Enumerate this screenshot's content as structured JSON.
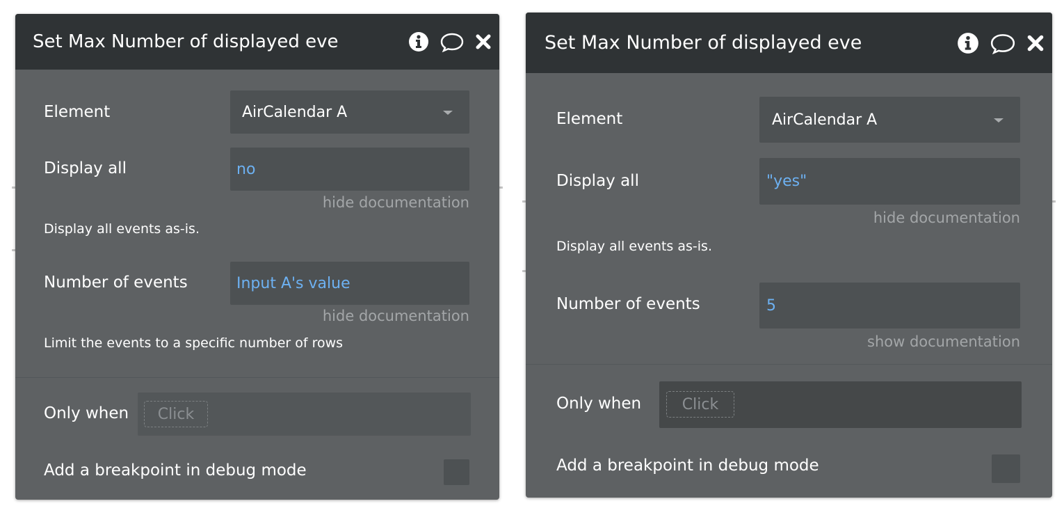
{
  "panels": [
    {
      "title": "Set Max Number of displayed eve",
      "icons": [
        "info-icon",
        "comment-icon",
        "close-icon"
      ],
      "element": {
        "label": "Element",
        "value": "AirCalendar A"
      },
      "display_all": {
        "label": "Display all",
        "value": "no",
        "doc_link": "hide documentation",
        "doc_text": "Display all events as-is."
      },
      "number_of_events": {
        "label": "Number of events",
        "value": "Input A's value",
        "doc_link": "hide documentation",
        "doc_text": "Limit the events to a specific number of rows"
      },
      "only_when": {
        "label": "Only when",
        "placeholder": "Click"
      },
      "breakpoint": {
        "label": "Add a breakpoint in debug mode"
      }
    },
    {
      "title": "Set Max Number of displayed eve",
      "icons": [
        "info-icon",
        "comment-icon",
        "close-icon"
      ],
      "element": {
        "label": "Element",
        "value": "AirCalendar A"
      },
      "display_all": {
        "label": "Display all",
        "value": "\"yes\"",
        "doc_link": "hide documentation",
        "doc_text": "Display all events as-is."
      },
      "number_of_events": {
        "label": "Number of events",
        "value": "5",
        "doc_link": "show documentation"
      },
      "only_when": {
        "label": "Only when",
        "placeholder": "Click"
      },
      "breakpoint": {
        "label": "Add a breakpoint in debug mode"
      }
    }
  ],
  "colors": {
    "header_bg": "#2f3335",
    "panel_bg": "#5e6163",
    "field_bg": "#4d5153",
    "dynamic_value": "#6db1f2",
    "doc_link": "#a3a6a8"
  }
}
